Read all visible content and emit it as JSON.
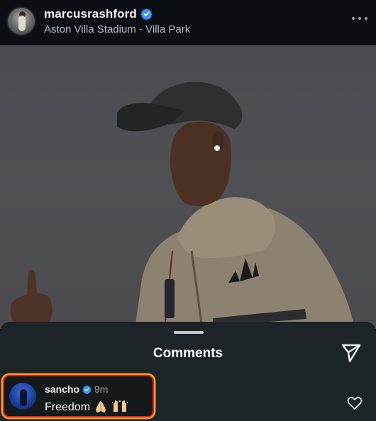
{
  "post": {
    "username": "marcusrashford",
    "location": "Aston Villa Stadium - Villa Park",
    "verified": true
  },
  "icons": {
    "more": "more-options-icon",
    "verified": "verified-badge-icon",
    "share": "paper-plane-icon",
    "like": "heart-outline-icon"
  },
  "comments": {
    "title": "Comments",
    "items": [
      {
        "username": "sancho",
        "verified": true,
        "time": "9m",
        "text": "Freedom",
        "emojis": [
          "folded-hands",
          "raising-hands"
        ]
      }
    ]
  },
  "colors": {
    "verified_blue": "#3897f0",
    "highlight_outer": "#f0a020",
    "highlight_inner": "#e0202a"
  }
}
